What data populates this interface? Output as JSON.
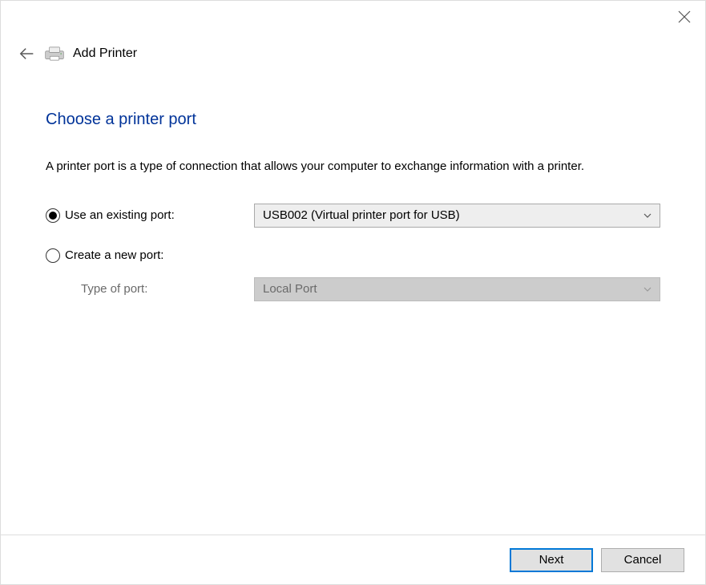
{
  "header": {
    "wizard_title": "Add Printer"
  },
  "page": {
    "heading": "Choose a printer port",
    "description": "A printer port is a type of connection that allows your computer to exchange information with a printer."
  },
  "options": {
    "existing_port": {
      "label": "Use an existing port:",
      "checked": true,
      "selected_value": "USB002 (Virtual printer port for USB)"
    },
    "new_port": {
      "label": "Create a new port:",
      "checked": false,
      "type_label": "Type of port:",
      "type_value": "Local Port"
    }
  },
  "footer": {
    "next_label": "Next",
    "cancel_label": "Cancel"
  }
}
